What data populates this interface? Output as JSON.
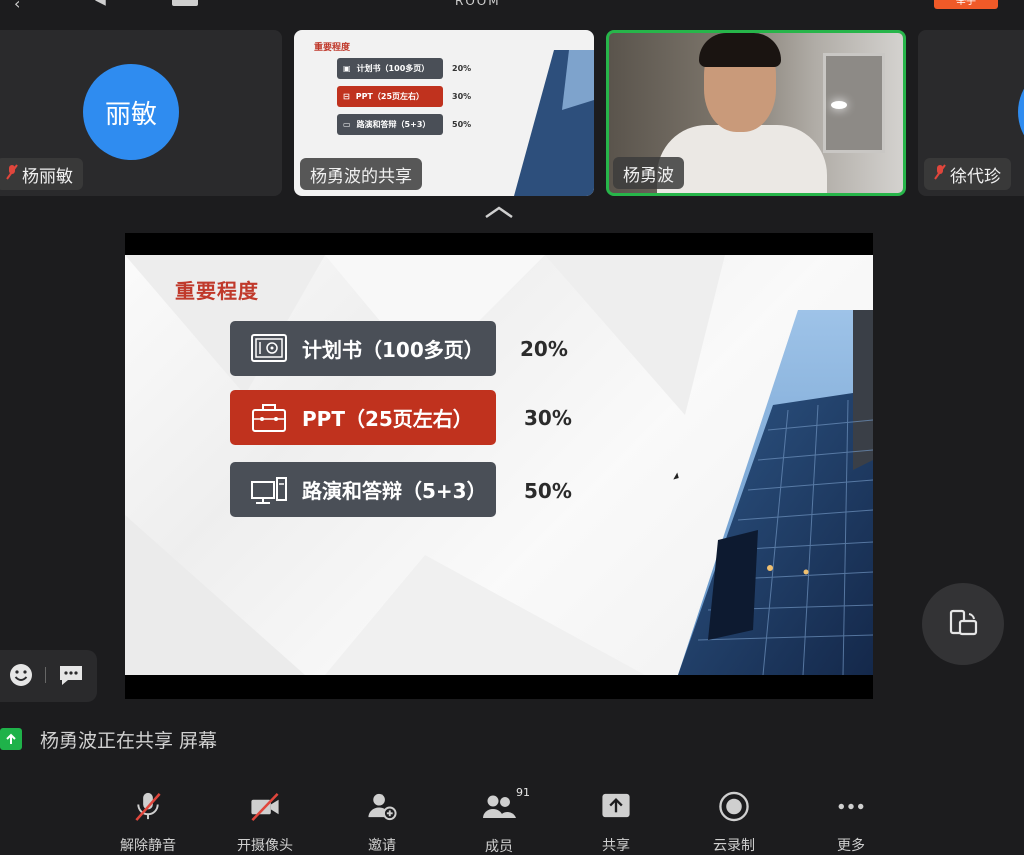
{
  "topbar": {
    "title": "ROOM",
    "orange_label": "举手"
  },
  "participants": [
    {
      "name": "杨丽敏",
      "avatar_text": "丽敏",
      "muted": true
    },
    {
      "name": "杨勇波的共享"
    },
    {
      "name": "杨勇波"
    },
    {
      "name": "徐代珍",
      "muted": true
    }
  ],
  "slide": {
    "title": "重要程度",
    "items": [
      {
        "label": "计划书（100多页）",
        "percent": "20%",
        "color": "#4a4f57",
        "icon": "safe-icon"
      },
      {
        "label": "PPT（25页左右）",
        "percent": "30%",
        "color": "#c0321e",
        "icon": "briefcase-icon"
      },
      {
        "label": "路演和答辩（5+3）",
        "percent": "50%",
        "color": "#4a4f57",
        "icon": "computer-icon"
      }
    ]
  },
  "share_notice": "杨勇波正在共享 屏幕",
  "toolbar": {
    "unmute": "解除静音",
    "camera": "开摄像头",
    "invite": "邀请",
    "members": "成员",
    "members_count": "91",
    "share": "共享",
    "record": "云录制",
    "more": "更多"
  },
  "colors": {
    "accent_green": "#27b54a",
    "accent_blue": "#2f8cf0",
    "brand_red": "#c0392b"
  }
}
